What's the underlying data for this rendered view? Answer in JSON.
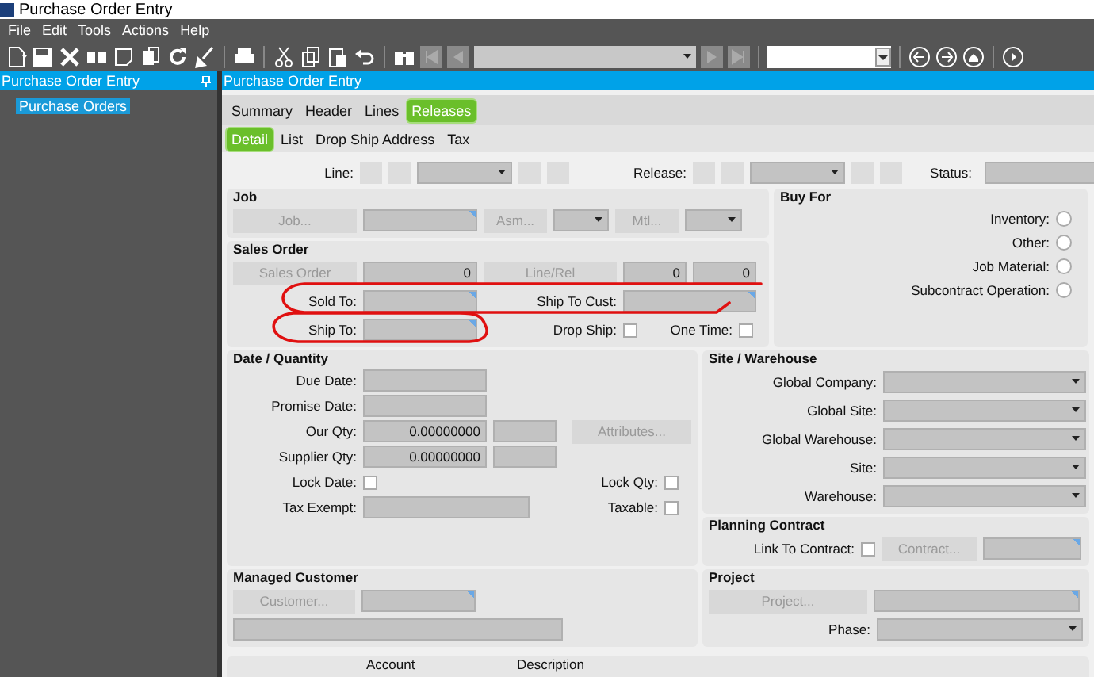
{
  "window": {
    "title": "Purchase Order Entry"
  },
  "menu": [
    "File",
    "Edit",
    "Tools",
    "Actions",
    "Help"
  ],
  "left_panel": {
    "title": "Purchase Order Entry",
    "items": [
      {
        "label": "Purchase Orders",
        "selected": true
      }
    ]
  },
  "main_panel": {
    "title": "Purchase Order Entry"
  },
  "tabs": [
    {
      "label": "Summary",
      "selected": false
    },
    {
      "label": "Header",
      "selected": false
    },
    {
      "label": "Lines",
      "selected": false
    },
    {
      "label": "Releases",
      "selected": true
    }
  ],
  "subtabs": [
    {
      "label": "Detail",
      "selected": true
    },
    {
      "label": "List",
      "selected": false
    },
    {
      "label": "Drop Ship Address",
      "selected": false
    },
    {
      "label": "Tax",
      "selected": false
    }
  ],
  "record_nav": {
    "line_label": "Line:",
    "release_label": "Release:",
    "status_label": "Status:"
  },
  "job": {
    "title": "Job",
    "job_button": "Job...",
    "asm_button": "Asm...",
    "mtl_button": "Mtl..."
  },
  "sales_order": {
    "title": "Sales Order",
    "order_button": "Sales Order",
    "order_value": "0",
    "line_button": "Line/Rel",
    "line_value": "0",
    "rel_value": "0",
    "sold_to_label": "Sold To:",
    "ship_to_cust_label": "Ship To Cust:",
    "ship_to_label": "Ship To:",
    "drop_ship": {
      "label": "Drop Ship:",
      "checked": false
    },
    "one_time": {
      "label": "One Time:",
      "checked": false
    }
  },
  "buy_for": {
    "title": "Buy For",
    "options": [
      {
        "label": "Inventory:",
        "selected": false
      },
      {
        "label": "Other:",
        "selected": false
      },
      {
        "label": "Job Material:",
        "selected": false
      },
      {
        "label": "Subcontract Operation:",
        "selected": false
      }
    ]
  },
  "date_quantity": {
    "title": "Date / Quantity",
    "due_date_label": "Due Date:",
    "promise_date_label": "Promise Date:",
    "our_qty": {
      "label": "Our Qty:",
      "value": "0.00000000"
    },
    "supplier_qty": {
      "label": "Supplier Qty:",
      "value": "0.00000000"
    },
    "attributes_button": "Attributes...",
    "lock_date": {
      "label": "Lock Date:",
      "checked": false
    },
    "lock_qty": {
      "label": "Lock Qty:",
      "checked": false
    },
    "tax_exempt_label": "Tax Exempt:",
    "taxable": {
      "label": "Taxable:",
      "checked": false
    }
  },
  "site_warehouse": {
    "title": "Site / Warehouse",
    "fields": [
      "Global Company:",
      "Global Site:",
      "Global Warehouse:",
      "Site:",
      "Warehouse:"
    ]
  },
  "planning_contract": {
    "title": "Planning Contract",
    "link": {
      "label": "Link To Contract:",
      "checked": false
    },
    "contract_button": "Contract..."
  },
  "managed_customer": {
    "title": "Managed Customer",
    "customer_button": "Customer..."
  },
  "project": {
    "title": "Project",
    "project_button": "Project...",
    "phase_label": "Phase:"
  },
  "grid": {
    "columns": [
      "Account",
      "Description"
    ]
  }
}
